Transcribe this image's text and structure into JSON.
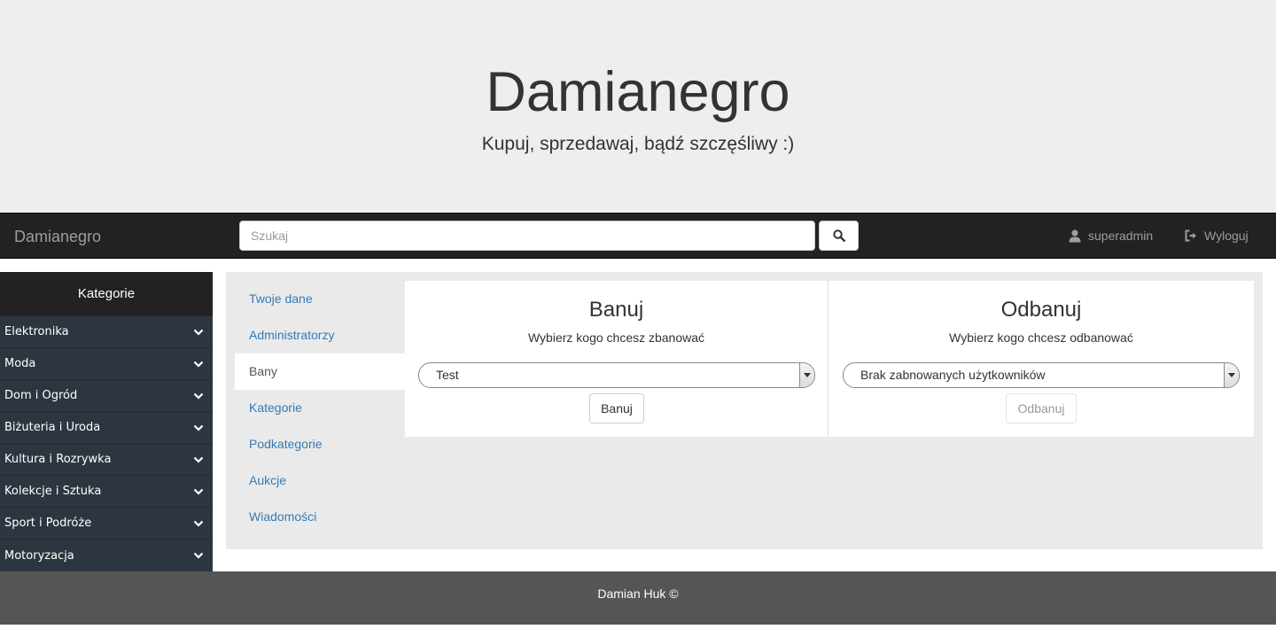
{
  "jumbotron": {
    "title": "Damianegro",
    "subtitle": "Kupuj, sprzedawaj, bądź szczęśliwy :)"
  },
  "navbar": {
    "brand": "Damianegro",
    "search_placeholder": "Szukaj",
    "search_value": "",
    "search_icon": "search-icon",
    "user_label": "superadmin",
    "user_icon": "user-icon",
    "logout_label": "Wyloguj",
    "logout_icon": "logout-icon"
  },
  "sidebar": {
    "title": "Kategorie",
    "items": [
      {
        "label": "Elektronika"
      },
      {
        "label": "Moda"
      },
      {
        "label": "Dom i Ogród"
      },
      {
        "label": "Biżuteria i Uroda"
      },
      {
        "label": "Kultura i Rozrywka"
      },
      {
        "label": "Kolekcje i Sztuka"
      },
      {
        "label": "Sport i Podróże"
      },
      {
        "label": "Motoryzacja"
      }
    ]
  },
  "admin_menu": {
    "items": [
      {
        "label": "Twoje dane",
        "active": false
      },
      {
        "label": "Administratorzy",
        "active": false
      },
      {
        "label": "Bany",
        "active": true
      },
      {
        "label": "Kategorie",
        "active": false
      },
      {
        "label": "Podkategorie",
        "active": false
      },
      {
        "label": "Aukcje",
        "active": false
      },
      {
        "label": "Wiadomości",
        "active": false
      }
    ]
  },
  "ban": {
    "title": "Banuj",
    "description": "Wybierz kogo chcesz zbanować",
    "selected": "Test",
    "button": "Banuj"
  },
  "unban": {
    "title": "Odbanuj",
    "description": "Wybierz kogo chcesz odbanować",
    "selected": "Brak zabnowanych użytkowników",
    "button": "Odbanuj"
  },
  "footer": {
    "text": "Damian Huk ©"
  },
  "colors": {
    "jumbotron_bg": "#eeeeee",
    "navbar_bg": "#222222",
    "sidebar_bg": "#2d3640",
    "link": "#337ab7",
    "footer_bg": "#555555"
  }
}
